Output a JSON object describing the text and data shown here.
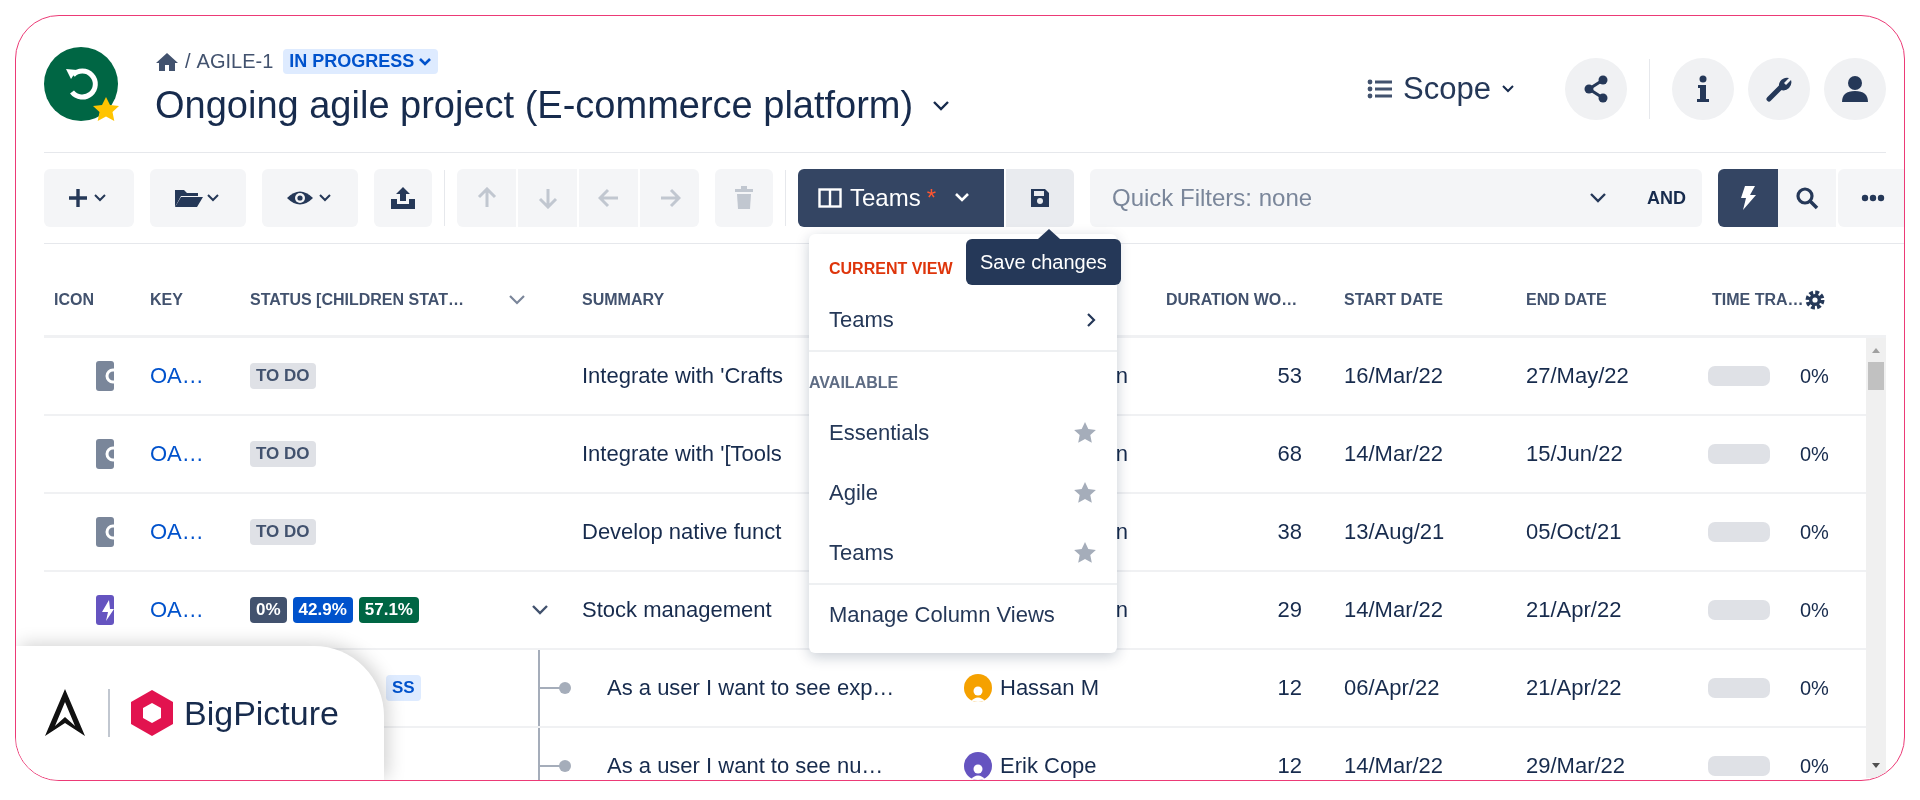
{
  "breadcrumb": {
    "separator": "/",
    "key": "AGILE-1",
    "status": "IN PROGRESS"
  },
  "title": "Ongoing agile project (E-commerce platform)",
  "scope": {
    "label": "Scope"
  },
  "toolbar": {
    "view": {
      "label": "Teams",
      "modified": "*"
    },
    "quick_filters": {
      "placeholder": "Quick Filters: none",
      "operator": "AND"
    },
    "nav_disabled": true,
    "smart_mode": {
      "on": true
    }
  },
  "view_menu": {
    "current_label": "CURRENT VIEW",
    "current": "Teams",
    "available_label": "AVAILABLE",
    "available": [
      {
        "label": "Essentials",
        "favorite": false
      },
      {
        "label": "Agile",
        "favorite": false
      },
      {
        "label": "Teams",
        "favorite": false
      }
    ],
    "manage": "Manage Column Views"
  },
  "tooltip": "Save changes",
  "table": {
    "columns": [
      "ICON",
      "KEY",
      "STATUS [CHILDREN STAT…",
      "SUMMARY",
      "DURATION WO…",
      "START DATE",
      "END DATE",
      "TIME TRA…"
    ],
    "rows": [
      {
        "kind": "task",
        "key": "OA…",
        "status": [
          {
            "text": "TO DO",
            "kind": "light",
            "color": "#dfe1e6"
          }
        ],
        "expanded": null,
        "summary": "Integrate with 'Crafts",
        "assignee": "n",
        "duration": "53",
        "start": "16/Mar/22",
        "end": "27/May/22",
        "time": {
          "level": 0,
          "reading": "0%"
        }
      },
      {
        "kind": "task",
        "key": "OA…",
        "status": [
          {
            "text": "TO DO",
            "kind": "light",
            "color": "#dfe1e6"
          }
        ],
        "expanded": null,
        "summary": "Integrate with '[Tools",
        "assignee": "n",
        "duration": "68",
        "start": "14/Mar/22",
        "end": "15/Jun/22",
        "time": {
          "level": 0,
          "reading": "0%"
        }
      },
      {
        "kind": "task",
        "key": "OA…",
        "status": [
          {
            "text": "TO DO",
            "kind": "light",
            "color": "#dfe1e6"
          }
        ],
        "expanded": null,
        "summary": "Develop native funct",
        "assignee": "n",
        "duration": "38",
        "start": "13/Aug/21",
        "end": "05/Oct/21",
        "time": {
          "level": 0,
          "reading": "0%"
        }
      },
      {
        "kind": "epic",
        "key": "OA…",
        "status": [
          {
            "text": "0%",
            "kind": "solid",
            "color": "#42526e"
          },
          {
            "text": "42.9%",
            "kind": "solid",
            "color": "#0052cc"
          },
          {
            "text": "57.1%",
            "kind": "solid",
            "color": "#006644"
          }
        ],
        "expanded": true,
        "summary": "Stock management",
        "assignee": "n",
        "duration": "29",
        "start": "14/Mar/22",
        "end": "21/Apr/22",
        "time": {
          "level": 0,
          "reading": "0%"
        }
      },
      {
        "kind": "child",
        "status": [
          {
            "text": "SS",
            "kind": "light",
            "color": "#deebff"
          }
        ],
        "summary": "As a user I want to see exp…",
        "assignee": "Hassan M",
        "avatar": {
          "color": "#f5a100"
        },
        "duration": "12",
        "start": "06/Apr/22",
        "end": "21/Apr/22",
        "time": {
          "level": 0,
          "reading": "0%"
        }
      },
      {
        "kind": "child",
        "status": [],
        "summary": "As a user I want to see nu…",
        "assignee": "Erik Cope",
        "avatar": {
          "color": "#6554c0"
        },
        "duration": "12",
        "start": "14/Mar/22",
        "end": "29/Mar/22",
        "time": {
          "level": 0,
          "reading": "0%"
        }
      }
    ]
  },
  "brand": {
    "name": "BigPicture"
  }
}
